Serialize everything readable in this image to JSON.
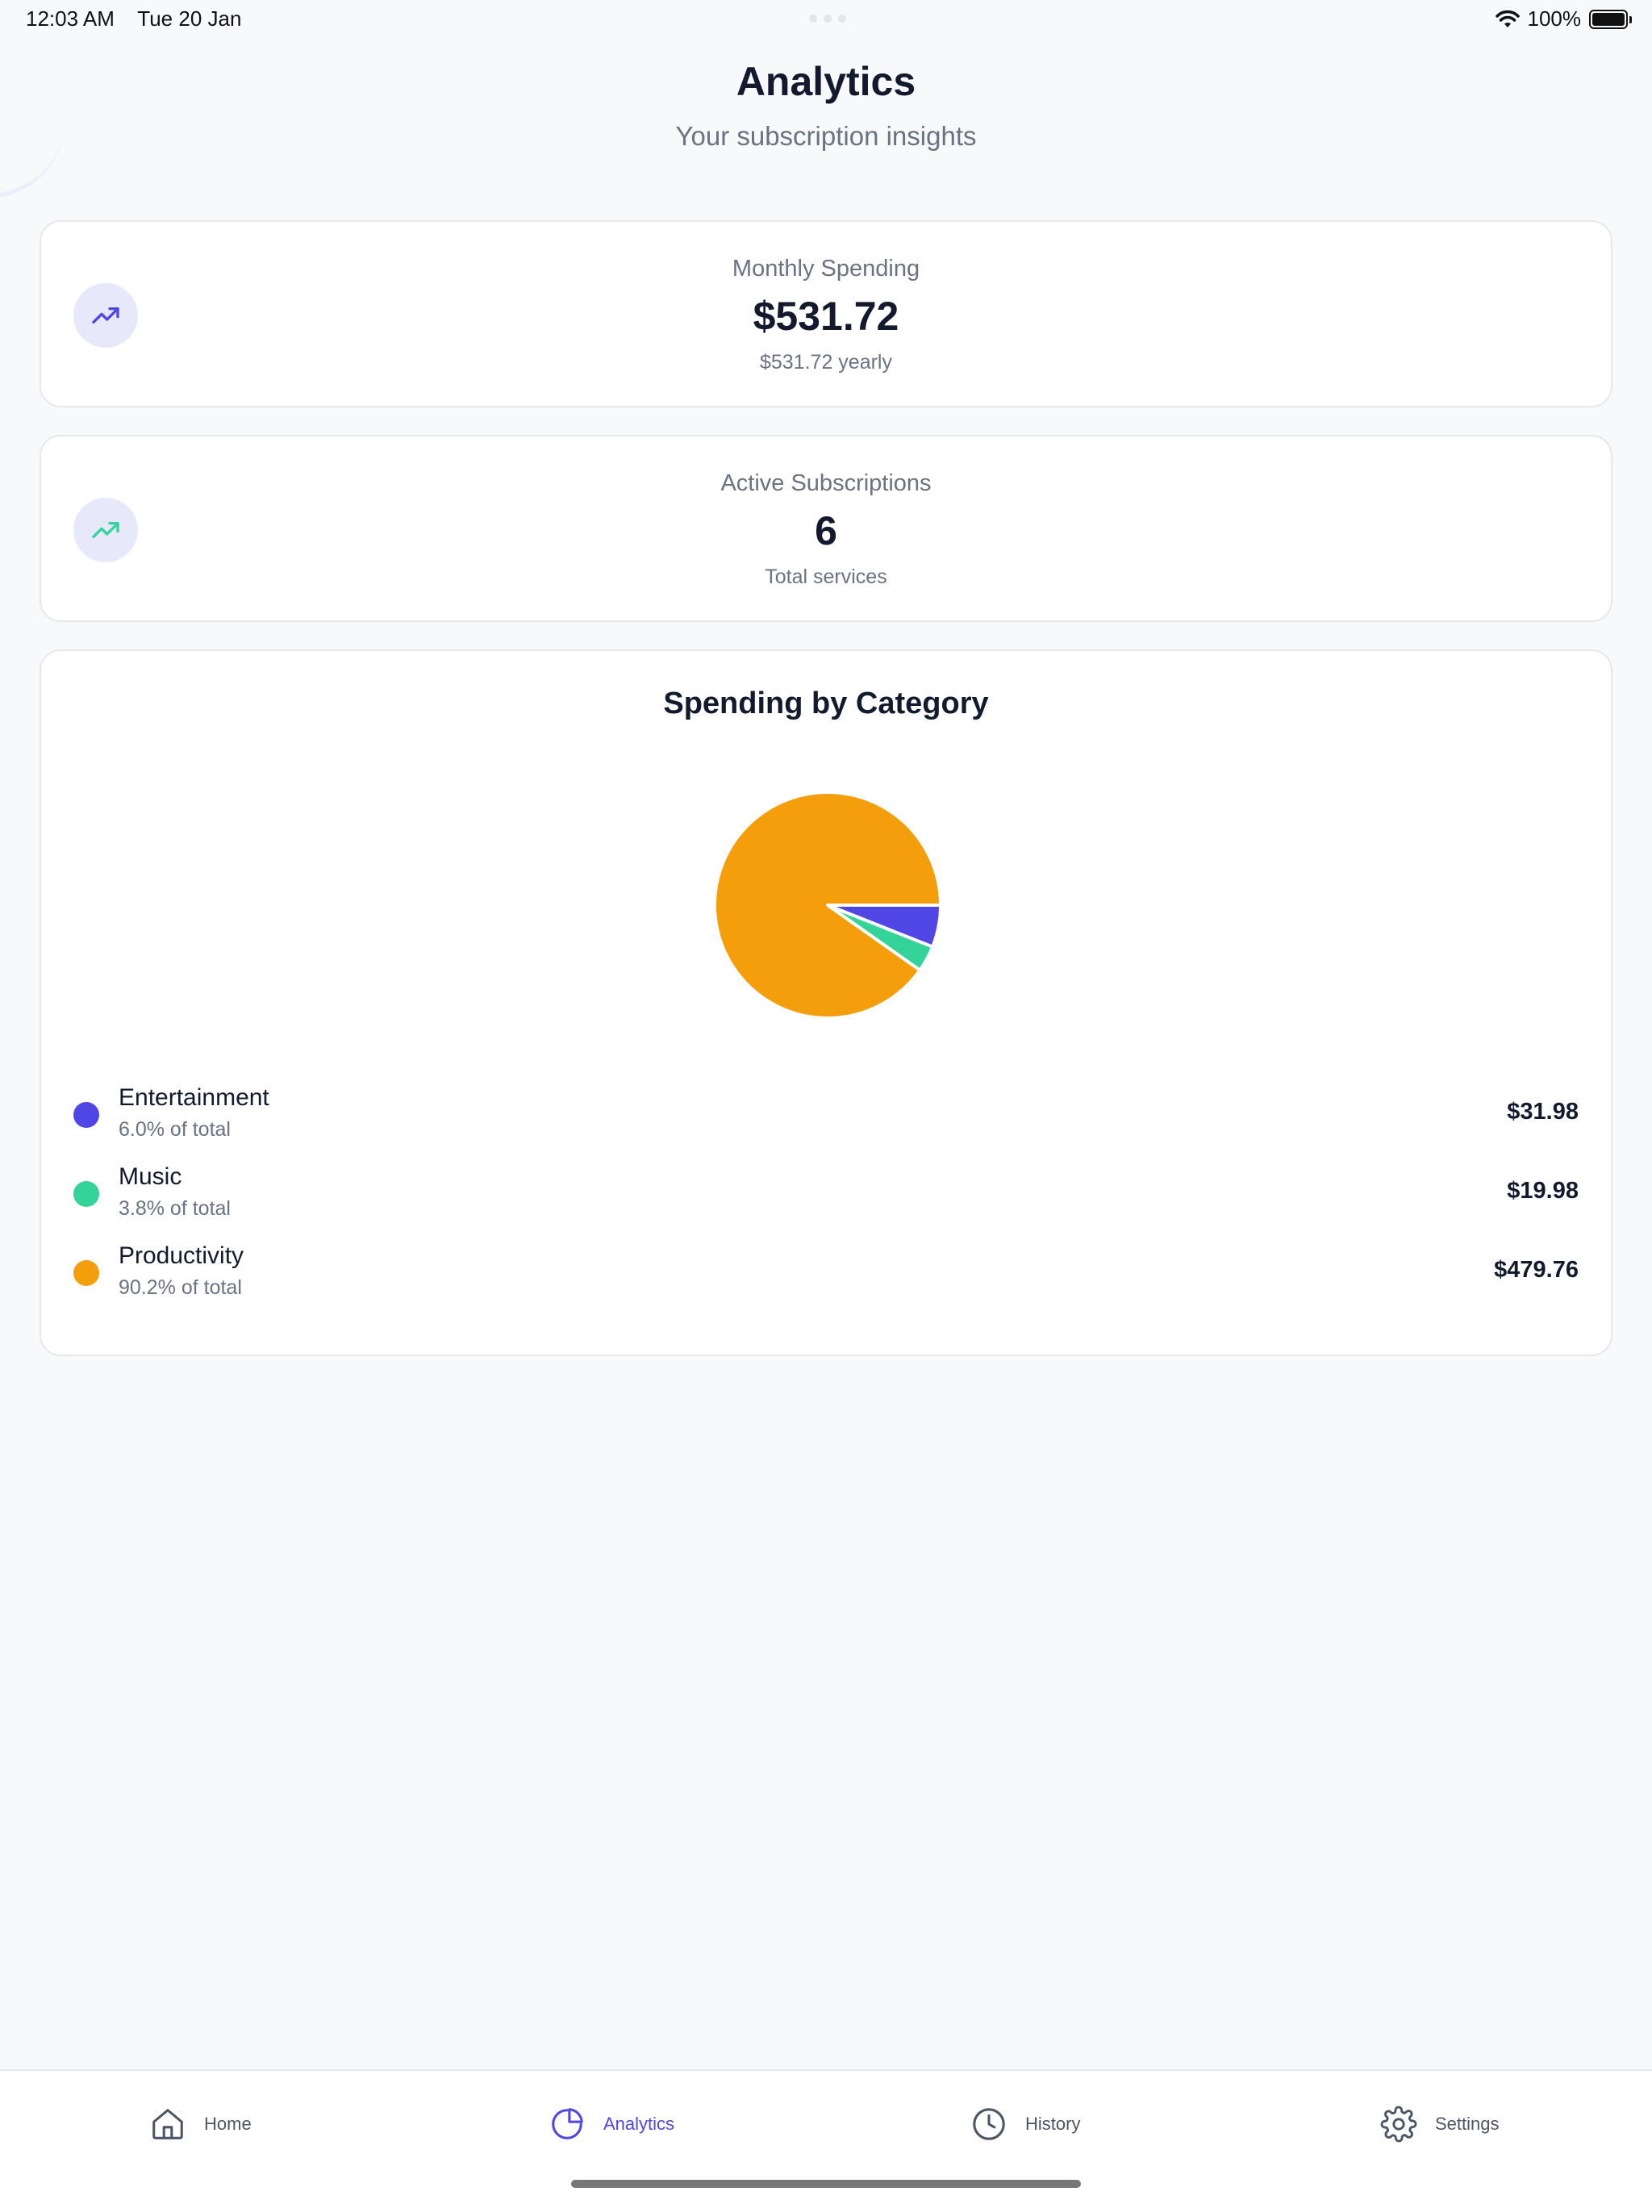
{
  "status_bar": {
    "time": "12:03 AM",
    "date": "Tue 20 Jan",
    "battery": "100%"
  },
  "header": {
    "title": "Analytics",
    "subtitle": "Your subscription insights"
  },
  "monthly_card": {
    "label": "Monthly Spending",
    "value": "$531.72",
    "sub": "$531.72 yearly",
    "icon": "trending-up-icon",
    "icon_color": "#4f46e5"
  },
  "active_card": {
    "label": "Active Subscriptions",
    "value": "6",
    "sub": "Total services",
    "icon": "trending-up-icon",
    "icon_color": "#34d399"
  },
  "category": {
    "title": "Spending by Category",
    "items": [
      {
        "name": "Entertainment",
        "pct": "6.0% of total",
        "amount": "$31.98",
        "color": "#4f46e5"
      },
      {
        "name": "Music",
        "pct": "3.8% of total",
        "amount": "$19.98",
        "color": "#34d399"
      },
      {
        "name": "Productivity",
        "pct": "90.2% of total",
        "amount": "$479.76",
        "color": "#f59e0b"
      }
    ]
  },
  "chart_data": {
    "type": "pie",
    "categories": [
      "Entertainment",
      "Music",
      "Productivity"
    ],
    "values": [
      31.98,
      19.98,
      479.76
    ],
    "colors": [
      "#4f46e5",
      "#34d399",
      "#f59e0b"
    ],
    "title": "Spending by Category"
  },
  "tabs": [
    {
      "label": "Home",
      "icon": "home-icon",
      "active": false
    },
    {
      "label": "Analytics",
      "icon": "pie-chart-icon",
      "active": true
    },
    {
      "label": "History",
      "icon": "clock-icon",
      "active": false
    },
    {
      "label": "Settings",
      "icon": "gear-icon",
      "active": false
    }
  ]
}
